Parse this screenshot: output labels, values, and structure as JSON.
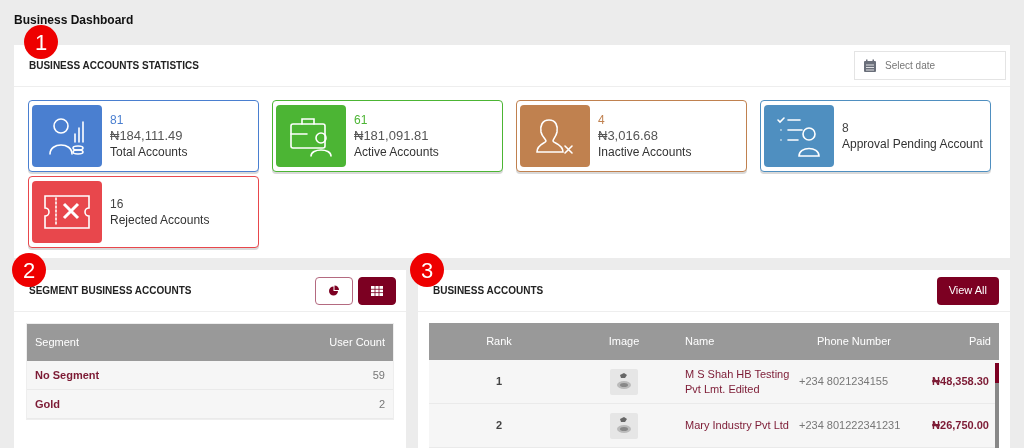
{
  "page_title": "Business Dashboard",
  "markers": [
    "1",
    "2",
    "3"
  ],
  "statistics": {
    "title": "BUSINESS ACCOUNTS STATISTICS",
    "date_field": {
      "placeholder": "Select date"
    },
    "cards": [
      {
        "kind": "total",
        "count": "81",
        "amount": "₦184,111.49",
        "label": "Total Accounts",
        "color": "#4a7fd0"
      },
      {
        "kind": "active",
        "count": "61",
        "amount": "₦181,091.81",
        "label": "Active Accounts",
        "color": "#4cb534"
      },
      {
        "kind": "inactive",
        "count": "4",
        "amount": "₦3,016.68",
        "label": "Inactive Accounts",
        "color": "#c0814f"
      },
      {
        "kind": "pending",
        "count": "8",
        "label": "Approval Pending Account",
        "color": "#4f8fc0"
      },
      {
        "kind": "rejected",
        "count": "16",
        "label": "Rejected Accounts",
        "color": "#e8474c"
      }
    ]
  },
  "segments": {
    "title": "SEGMENT BUSINESS ACCOUNTS",
    "view_toggle": [
      {
        "kind": "pie",
        "selected": false
      },
      {
        "kind": "table",
        "selected": true
      }
    ],
    "columns": [
      "Segment",
      "User Count"
    ],
    "rows": [
      {
        "segment": "No Segment",
        "count": "59"
      },
      {
        "segment": "Gold",
        "count": "2"
      }
    ]
  },
  "business_accounts": {
    "title": "BUSINESS ACCOUNTS",
    "view_all": "View All",
    "columns": [
      "Rank",
      "Image",
      "Name",
      "Phone Number",
      "Paid"
    ],
    "rows": [
      {
        "rank": "1",
        "name": "M S Shah HB Testing Pvt Lmt. Edited",
        "phone": "+234 8021234155",
        "paid": "₦48,358.30"
      },
      {
        "rank": "2",
        "name": "Mary Industry Pvt Ltd",
        "phone": "+234 801222341231",
        "paid": "₦26,750.00"
      }
    ]
  }
}
